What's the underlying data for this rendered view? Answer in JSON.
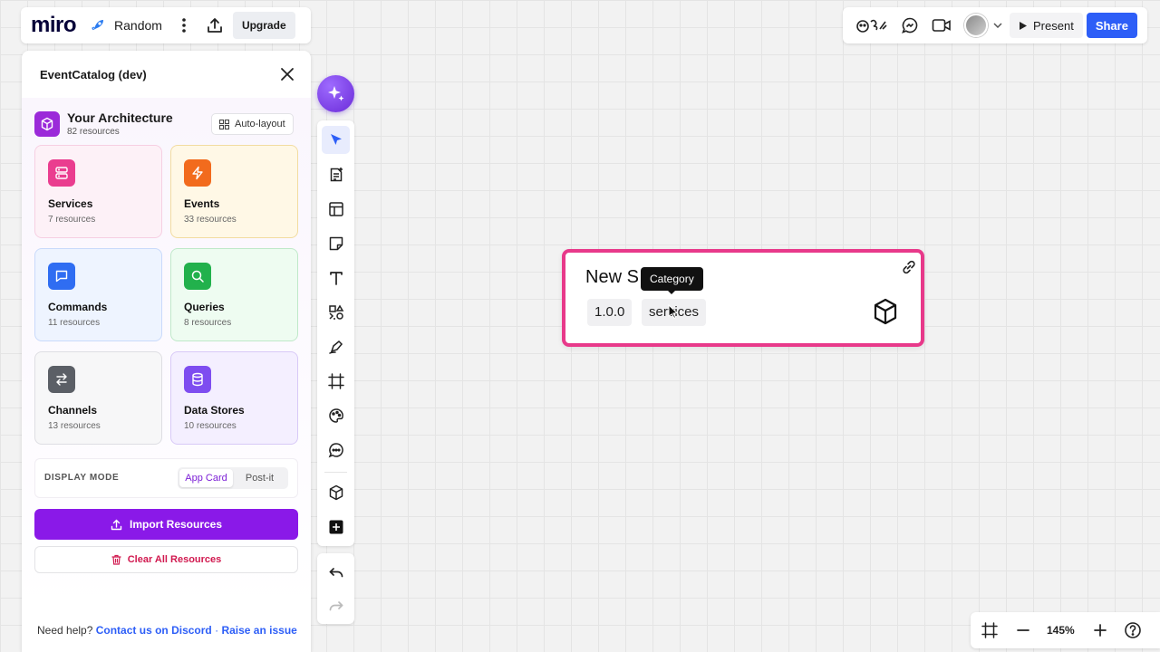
{
  "topbar": {
    "logo": "miro",
    "board_name": "Random",
    "upgrade_label": "Upgrade",
    "present_label": "Present",
    "share_label": "Share"
  },
  "panel": {
    "title": "EventCatalog (dev)",
    "architecture": {
      "title": "Your Architecture",
      "count": "82 resources",
      "autolayout_label": "Auto-layout"
    },
    "cards": [
      {
        "title": "Services",
        "sub": "7 resources",
        "icon": "server-icon",
        "bg": "#fdf1f7",
        "border": "#f6cfe2",
        "icon_bg": "#ea3d8f"
      },
      {
        "title": "Events",
        "sub": "33 resources",
        "icon": "bolt-icon",
        "bg": "#fff8e6",
        "border": "#f2dca0",
        "icon_bg": "#f26b1d"
      },
      {
        "title": "Commands",
        "sub": "11 resources",
        "icon": "message-square-icon",
        "bg": "#eef4ff",
        "border": "#c9dafb",
        "icon_bg": "#2f6df2"
      },
      {
        "title": "Queries",
        "sub": "8 resources",
        "icon": "search-icon",
        "bg": "#eefcf1",
        "border": "#bfe9c9",
        "icon_bg": "#22b14c"
      },
      {
        "title": "Channels",
        "sub": "13 resources",
        "icon": "arrows-swap-icon",
        "bg": "#f7f7f8",
        "border": "#dedee3",
        "icon_bg": "#5b5f66"
      },
      {
        "title": "Data Stores",
        "sub": "10 resources",
        "icon": "database-icon",
        "bg": "#f4efff",
        "border": "#d8c9f7",
        "icon_bg": "#7e4df0"
      }
    ],
    "display_mode": {
      "label": "DISPLAY MODE",
      "options": [
        "App Card",
        "Post-it"
      ],
      "selected": "App Card"
    },
    "import_label": "Import Resources",
    "clear_label": "Clear All Resources",
    "help": {
      "prefix": "Need help?",
      "discord": "Contact us on Discord",
      "separator": "·",
      "issue": "Raise an issue"
    }
  },
  "canvas_card": {
    "name": "New S",
    "version": "1.0.0",
    "category": "services",
    "tooltip": "Category",
    "border_color": "#e8398a"
  },
  "zoom": {
    "level": "145%"
  }
}
